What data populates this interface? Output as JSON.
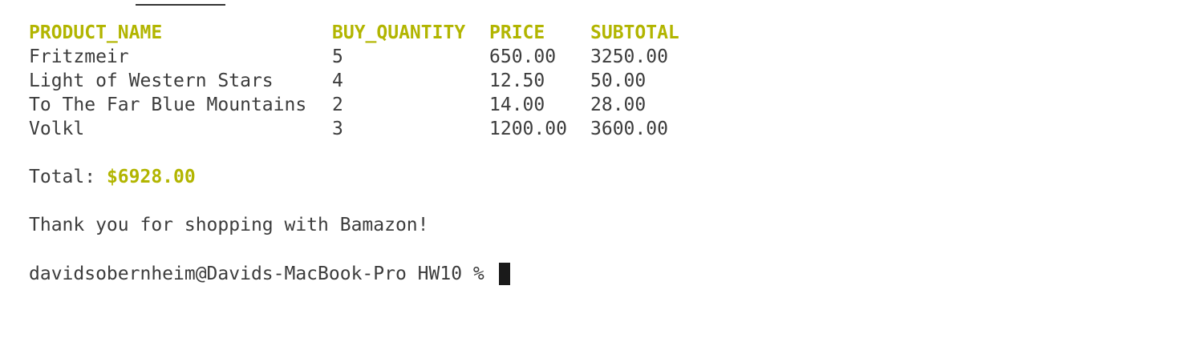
{
  "table": {
    "headers": [
      "PRODUCT_NAME",
      "BUY_QUANTITY",
      "PRICE",
      "SUBTOTAL"
    ],
    "rows": [
      [
        "Fritzmeir",
        "5",
        "650.00",
        "3250.00"
      ],
      [
        "Light of Western Stars",
        "4",
        "12.50",
        "50.00"
      ],
      [
        "To The Far Blue Mountains",
        "2",
        "14.00",
        "28.00"
      ],
      [
        "Volkl",
        "3",
        "1200.00",
        "3600.00"
      ]
    ]
  },
  "total": {
    "label": "Total: ",
    "amount": "$6928.00"
  },
  "thank_you": "Thank you for shopping with Bamazon!",
  "prompt": {
    "text": "davidsobernheim@Davids-MacBook-Pro HW10 % "
  },
  "colors": {
    "accent": "#b2b500",
    "text": "#3c3c3c",
    "background": "#ffffff"
  }
}
